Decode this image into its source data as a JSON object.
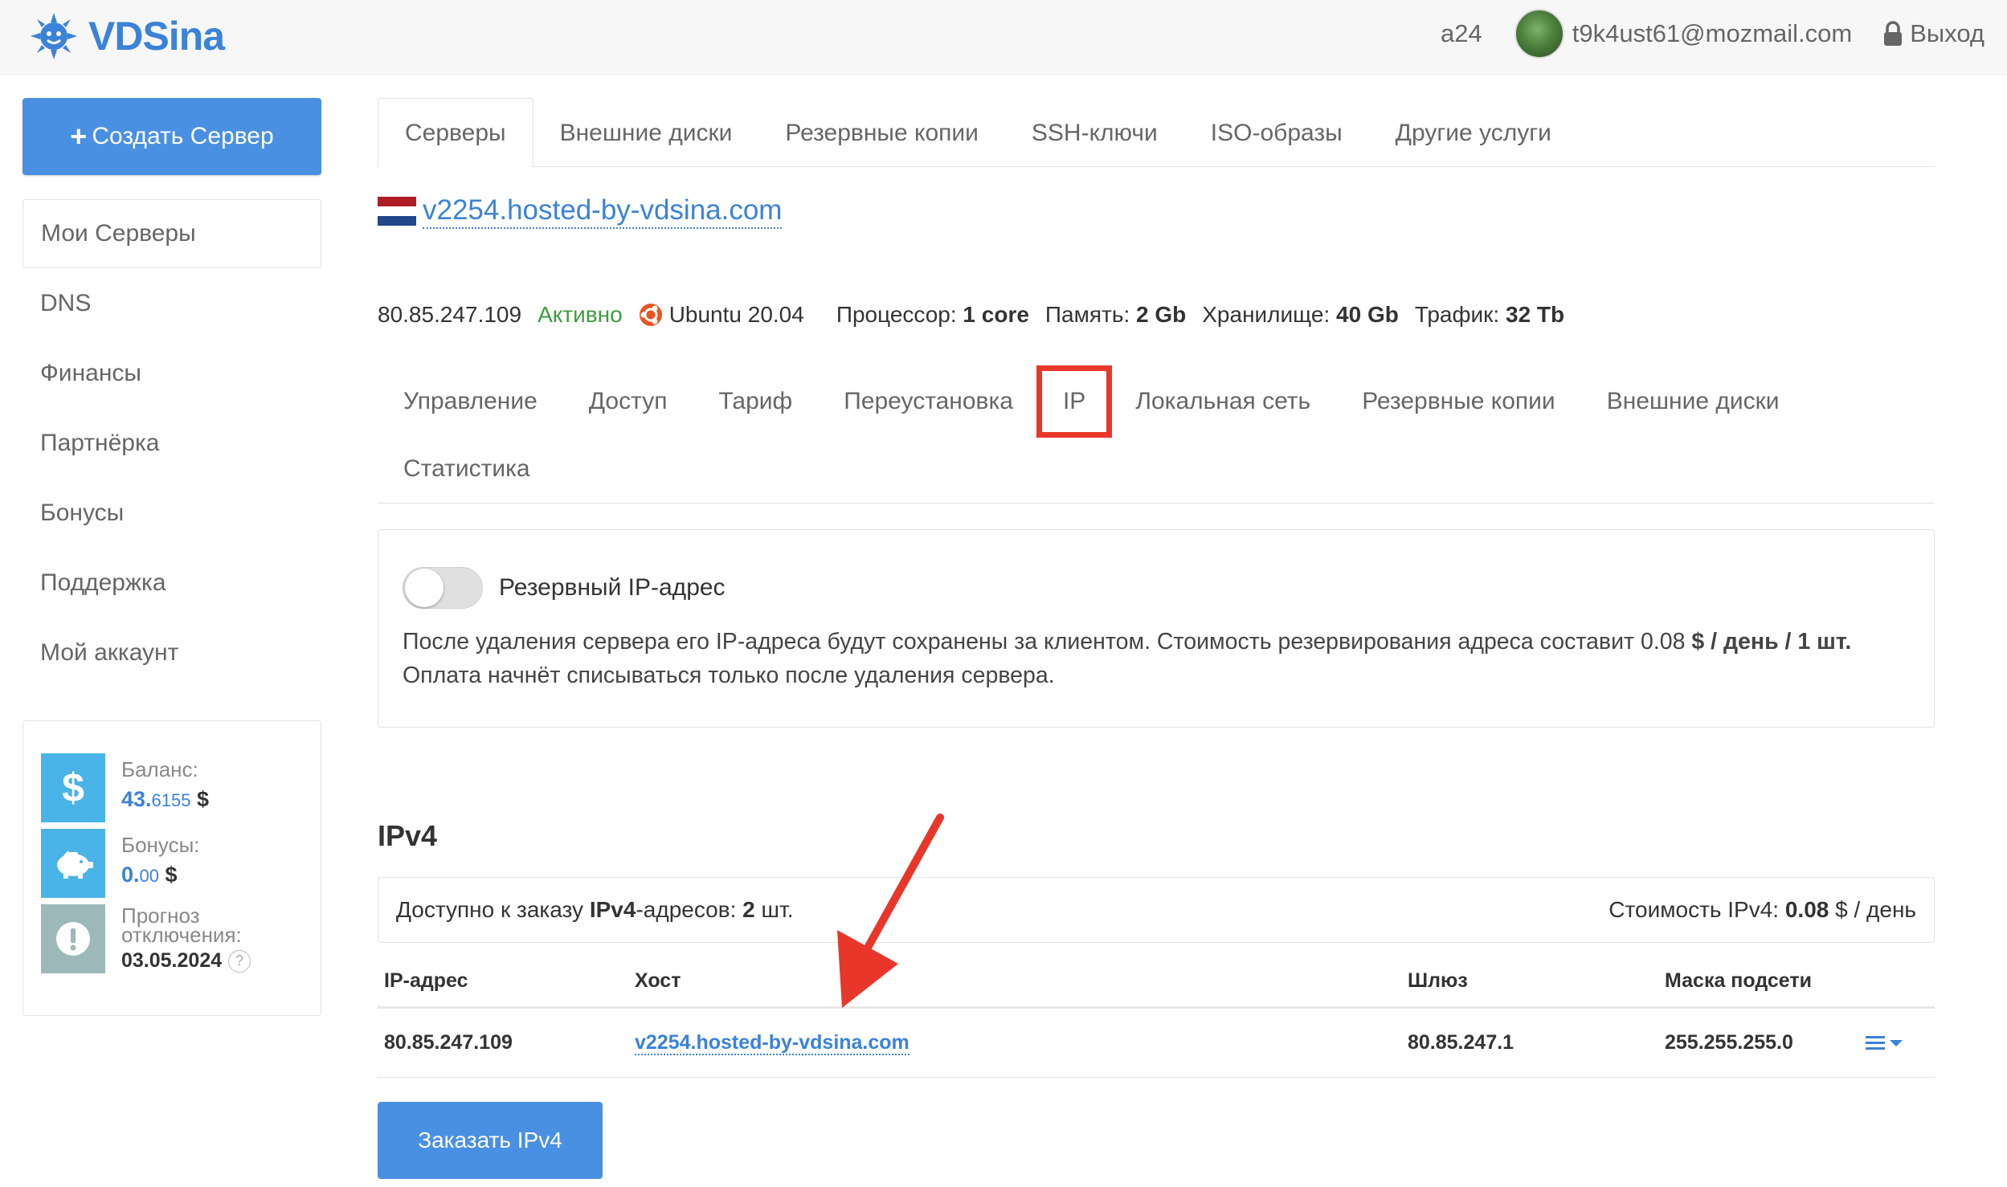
{
  "header": {
    "logo_text": "VDSina",
    "account_id": "a24",
    "email": "t9k4ust61@mozmail.com",
    "logout_label": "Выход"
  },
  "sidebar": {
    "create_button": "Создать Сервер",
    "items": [
      {
        "label": "Мои Серверы"
      },
      {
        "label": "DNS"
      },
      {
        "label": "Финансы"
      },
      {
        "label": "Партнёрка"
      },
      {
        "label": "Бонусы"
      },
      {
        "label": "Поддержка"
      },
      {
        "label": "Мой аккаунт"
      }
    ],
    "balance": {
      "balance_label": "Баланс:",
      "balance_int": "43.",
      "balance_frac": "6155",
      "balance_cur": "$",
      "bonus_label": "Бонусы:",
      "bonus_int": "0.",
      "bonus_frac": "00",
      "bonus_cur": "$",
      "forecast_label": "Прогноз отключения:",
      "forecast_date": "03.05.2024",
      "help_mark": "?"
    }
  },
  "tabs": [
    {
      "label": "Серверы"
    },
    {
      "label": "Внешние диски"
    },
    {
      "label": "Резервные копии"
    },
    {
      "label": "SSH-ключи"
    },
    {
      "label": "ISO-образы"
    },
    {
      "label": "Другие услуги"
    }
  ],
  "server": {
    "hostname": "v2254.hosted-by-vdsina.com",
    "ip": "80.85.247.109",
    "status": "Активно",
    "os": "Ubuntu 20.04",
    "cpu_label": "Процессор:",
    "cpu_value": "1 core",
    "ram_label": "Память:",
    "ram_value": "2 Gb",
    "storage_label": "Хранилище:",
    "storage_value": "40 Gb",
    "traffic_label": "Трафик:",
    "traffic_value": "32 Tb"
  },
  "subtabs": [
    {
      "label": "Управление"
    },
    {
      "label": "Доступ"
    },
    {
      "label": "Тариф"
    },
    {
      "label": "Переустановка"
    },
    {
      "label": "IP"
    },
    {
      "label": "Локальная сеть"
    },
    {
      "label": "Резервные копии"
    },
    {
      "label": "Внешние диски"
    },
    {
      "label": "Статистика"
    }
  ],
  "reserve": {
    "toggle_label": "Резервный IP-адрес",
    "toggle_on": false,
    "text_1": "После удаления сервера его IP-адреса будут сохранены за клиентом. Стоимость резервирования адреса составит 0.08 ",
    "text_price_unit": "$ / день / 1 шт.",
    "text_2": " Оплата начнёт списываться только после удаления сервера."
  },
  "ipv4": {
    "heading": "IPv4",
    "available_prefix": "Доступно к заказу ",
    "available_bold1": "IPv4",
    "available_mid": "-адресов: ",
    "available_count": "2",
    "available_suffix": " шт.",
    "cost_prefix": "Стоимость IPv4: ",
    "cost_value": "0.08",
    "cost_suffix": " $ / день",
    "columns": [
      "IP-адрес",
      "Хост",
      "Шлюз",
      "Маска подсети"
    ],
    "rows": [
      {
        "ip": "80.85.247.109",
        "host": "v2254.hosted-by-vdsina.com",
        "gateway": "80.85.247.1",
        "mask": "255.255.255.0"
      }
    ],
    "order_button": "Заказать IPv4"
  },
  "colors": {
    "accent": "#4a90e2",
    "link": "#3b82d8",
    "active_status": "#3c9d3c",
    "highlight": "#e8372a"
  }
}
